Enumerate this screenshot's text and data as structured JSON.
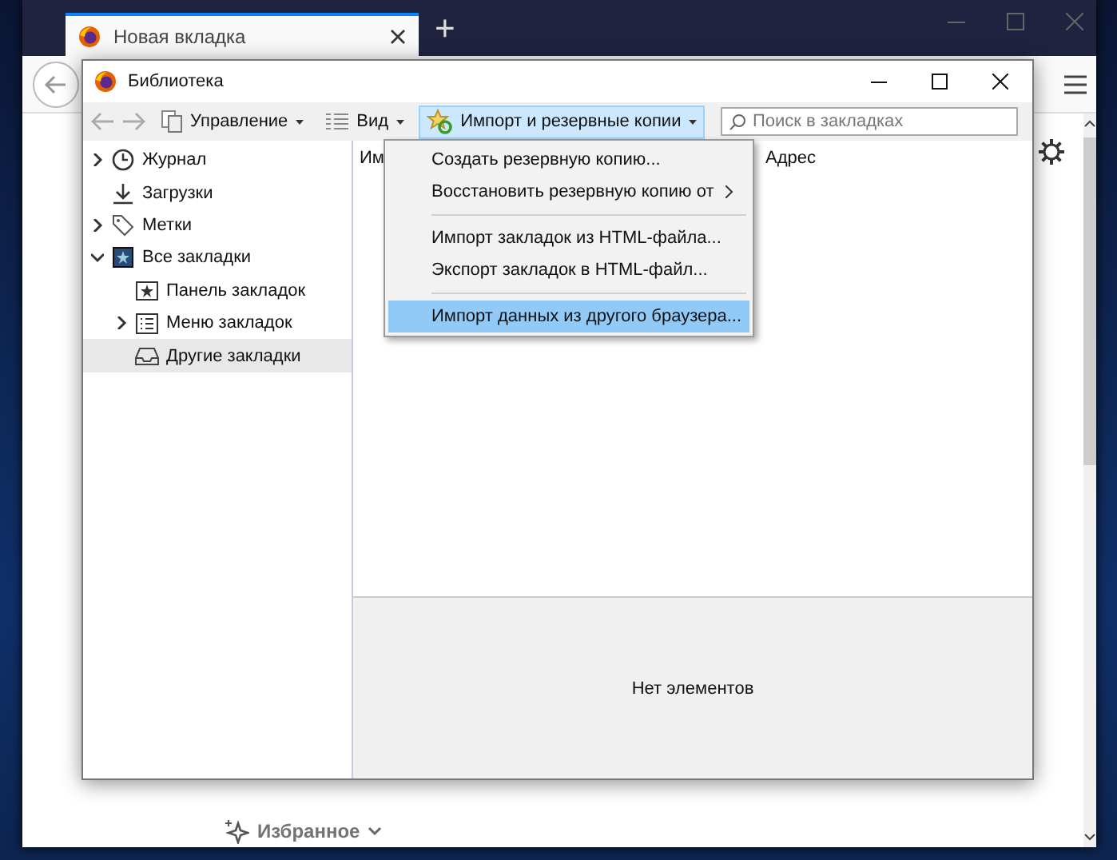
{
  "browser": {
    "tab": {
      "title": "Новая вкладка",
      "selected": true
    },
    "new_tab": "+",
    "bookmarks_bar": {
      "label": "Избранное"
    }
  },
  "library": {
    "title": "Библиотека",
    "toolbar": {
      "menus": [
        {
          "label": "Управление",
          "kind": "organize",
          "selected": false
        },
        {
          "label": "Вид",
          "kind": "view",
          "selected": false
        },
        {
          "label": "Импорт и резервные копии",
          "kind": "import",
          "selected": true
        }
      ],
      "search": {
        "placeholder": "Поиск в закладках"
      }
    },
    "sidebar": {
      "items": [
        {
          "label": "Журнал",
          "kind": "history",
          "expandable": true,
          "expanded": false,
          "selected": false
        },
        {
          "label": "Загрузки",
          "kind": "downloads",
          "expandable": false,
          "selected": false
        },
        {
          "label": "Метки",
          "kind": "tags",
          "expandable": true,
          "expanded": false,
          "selected": false
        },
        {
          "label": "Все закладки",
          "kind": "all",
          "expandable": true,
          "expanded": true,
          "selected": false,
          "children": [
            {
              "label": "Панель закладок",
              "kind": "toolbar",
              "expandable": false,
              "selected": false
            },
            {
              "label": "Меню закладок",
              "kind": "menu",
              "expandable": true,
              "expanded": false,
              "selected": false
            },
            {
              "label": "Другие закладки",
              "kind": "other",
              "expandable": false,
              "selected": true
            }
          ]
        }
      ]
    },
    "columns": [
      "Им",
      "Адрес"
    ],
    "details": {
      "message": "Нет элементов"
    }
  },
  "menu": {
    "items": [
      {
        "kind": "item",
        "label": "Создать резервную копию...",
        "submenu": false,
        "selected": false
      },
      {
        "kind": "item",
        "label": "Восстановить резервную копию от",
        "submenu": true,
        "selected": false
      },
      {
        "kind": "separator"
      },
      {
        "kind": "item",
        "label": "Импорт закладок из HTML-файла...",
        "submenu": false,
        "selected": false
      },
      {
        "kind": "item",
        "label": "Экспорт закладок в HTML-файл...",
        "submenu": false,
        "selected": false
      },
      {
        "kind": "separator"
      },
      {
        "kind": "item",
        "label": "Импорт данных из другого браузера...",
        "submenu": false,
        "selected": true
      }
    ]
  }
}
